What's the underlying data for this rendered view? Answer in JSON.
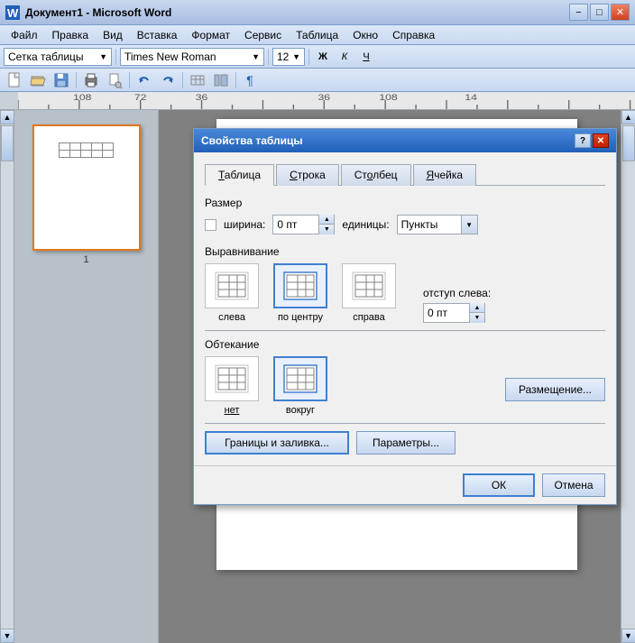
{
  "titlebar": {
    "icon": "W",
    "title": "Документ1 - Microsoft Word",
    "min_btn": "−",
    "max_btn": "□",
    "close_btn": "✕"
  },
  "menubar": {
    "items": [
      "Файл",
      "Правка",
      "Вид",
      "Вставка",
      "Формат",
      "Сервис",
      "Таблица",
      "Окно",
      "Справка"
    ]
  },
  "toolbar1": {
    "style_label": "Сетка таблицы",
    "font_name": "Times New Roman",
    "font_size": "12",
    "bold": "Ж",
    "italic": "К",
    "underline": "Ч"
  },
  "dialog": {
    "title": "Свойства таблицы",
    "help_btn": "?",
    "close_btn": "✕",
    "tabs": [
      "Таблица",
      "Строка",
      "Столбец",
      "Ячейка"
    ],
    "active_tab": "Таблица",
    "size_section": {
      "label": "Размер",
      "width_checkbox_label": "ширина:",
      "width_value": "0 пт",
      "units_label": "единицы:",
      "units_value": "Пункты"
    },
    "alignment_section": {
      "label": "Выравнивание",
      "options": [
        "слева",
        "по центру",
        "справа"
      ],
      "selected": "по центру",
      "indent_label": "отступ слева:",
      "indent_value": "0 пт"
    },
    "wrapping_section": {
      "label": "Обтекание",
      "options": [
        "нет",
        "вокруг"
      ],
      "selected": "вокруг",
      "placement_btn": "Размещение..."
    },
    "borders_btn": "Границы и заливка...",
    "options_btn": "Параметры...",
    "ok_btn": "ОК",
    "cancel_btn": "Отмена"
  },
  "page_thumb": {
    "page_num": "1"
  }
}
